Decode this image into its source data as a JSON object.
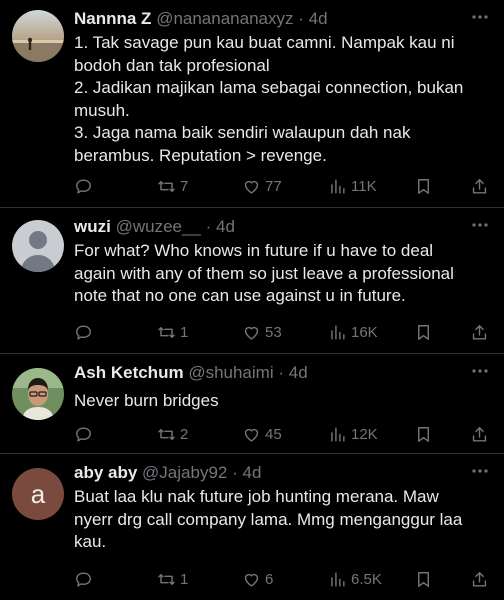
{
  "tweets": [
    {
      "name": "Nannna Z",
      "handle": "@nananananaxyz",
      "sep": "·",
      "time": "4d",
      "avatar_kind": "photo-beach",
      "lines": [
        "1. Tak savage pun kau buat camni. Nampak kau ni",
        "bodoh dan tak profesional",
        "2. Jadikan majikan lama sebagai connection, bukan",
        "musuh.",
        "3. Jaga nama baik sendiri walaupun dah nak",
        "berambus. Reputation > revenge."
      ],
      "replies": "",
      "retweets": "7",
      "likes": "77",
      "views": "11K"
    },
    {
      "name": "wuzi",
      "handle": "@wuzee__",
      "sep": "·",
      "time": "4d",
      "avatar_kind": "default-person",
      "lines": [
        "For what? Who knows in future if u have to deal",
        "again with any of them so just leave a professional",
        "note that no one can use against u in future."
      ],
      "replies": "",
      "retweets": "1",
      "likes": "53",
      "views": "16K"
    },
    {
      "name": "Ash Ketchum",
      "handle": "@shuhaimi",
      "sep": "·",
      "time": "4d",
      "avatar_kind": "photo-man",
      "lines": [
        "Never burn bridges"
      ],
      "replies": "",
      "retweets": "2",
      "likes": "45",
      "views": "12K"
    },
    {
      "name": "aby aby",
      "handle": "@Jajaby92",
      "sep": "·",
      "time": "4d",
      "avatar_kind": "letter",
      "avatar_letter": "a",
      "lines": [
        "Buat laa klu nak future job hunting merana. Maw",
        "nyerr drg call company lama. Mmg menganggur laa",
        "kau."
      ],
      "replies": "",
      "retweets": "1",
      "likes": "6",
      "views": "6.5K"
    }
  ],
  "colors": {
    "background": "#000000",
    "text": "#e7e9ea",
    "muted": "#71767b",
    "divider": "#2f3336",
    "letter_avatar": "#7a4a3e"
  },
  "icons": [
    "reply-icon",
    "retweet-icon",
    "like-icon",
    "views-icon",
    "bookmark-icon",
    "share-icon",
    "more-icon"
  ]
}
